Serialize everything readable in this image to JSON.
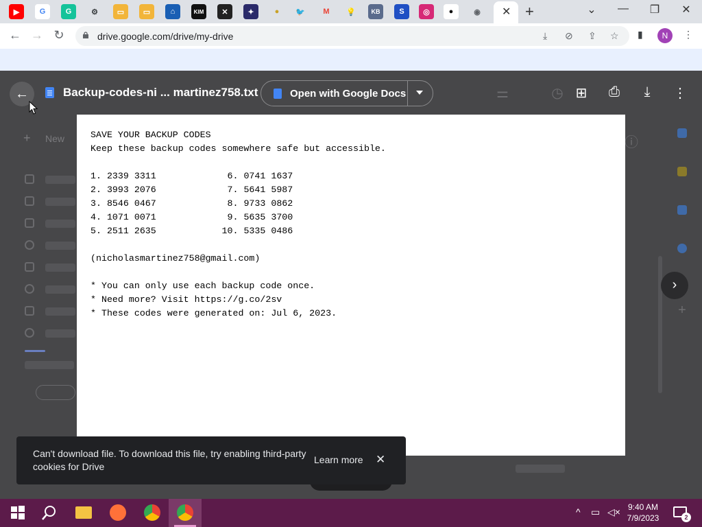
{
  "browser": {
    "url": "drive.google.com/drive/my-drive",
    "profile_initial": "N",
    "tab_icons": [
      "youtube-icon",
      "google-icon",
      "grammarly-icon",
      "settings-icon",
      "folder-icon",
      "folder-icon",
      "app-icon",
      "kim-icon",
      "game-icon",
      "game-icon",
      "circle-icon",
      "twitter-icon",
      "gmail-icon",
      "bulb-icon",
      "app-icon",
      "sonic-icon",
      "instagram-icon",
      "github-icon",
      "chrome-icon"
    ]
  },
  "viewer": {
    "file_title": "Backup-codes-ni ... martinez758.txt",
    "open_with_label": "Open with Google Docs",
    "background_new_label": "New"
  },
  "document": {
    "heading": "SAVE YOUR BACKUP CODES",
    "subheading": "Keep these backup codes somewhere safe but accessible.",
    "codes_left": [
      "1. 2339 3311",
      "2. 3993 2076",
      "3. 8546 0467",
      "4. 1071 0071",
      "5. 2511 2635"
    ],
    "codes_right": [
      " 6. 0741 1637",
      " 7. 5641 5987",
      " 8. 9733 0862",
      " 9. 5635 3700",
      "10. 5335 0486"
    ],
    "email": "(nicholasmartinez758@gmail.com)",
    "notes": [
      "* You can only use each backup code once.",
      "* Need more? Visit https://g.co/2sv",
      "* These codes were generated on: Jul 6, 2023."
    ]
  },
  "toast": {
    "message": "Can't download file. To download this file, try enabling third-party cookies for Drive",
    "link": "Learn more"
  },
  "taskbar": {
    "time": "9:40 AM",
    "date": "7/9/2023",
    "notification_count": "2"
  }
}
